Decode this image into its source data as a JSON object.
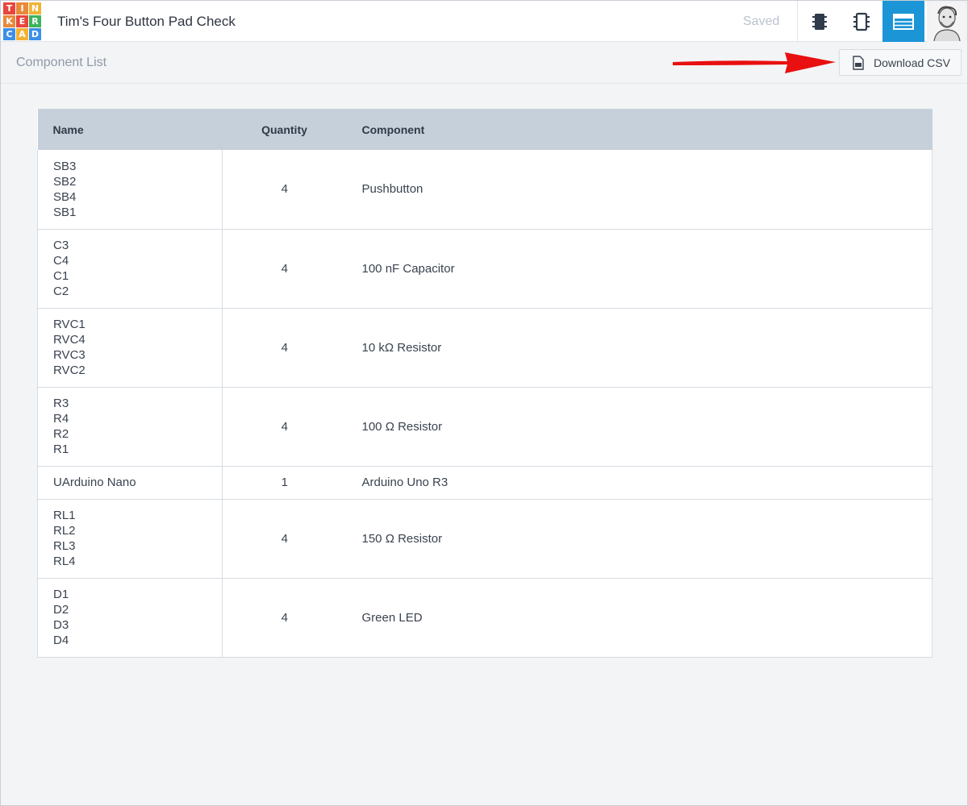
{
  "header": {
    "logo_letters": [
      "T",
      "I",
      "N",
      "K",
      "E",
      "R",
      "C",
      "A",
      "D"
    ],
    "logo_colors": [
      "#e8453c",
      "#e8893c",
      "#f2b233",
      "#e8893c",
      "#e8453c",
      "#3cb45a",
      "#3c8fe8",
      "#f2b233",
      "#3c8fe8"
    ],
    "title": "Tim's Four Button Pad Check",
    "status": "Saved",
    "accent": "#1c95d6"
  },
  "subbar": {
    "title": "Component List",
    "download_label": "Download CSV",
    "arrow_color": "#e81010"
  },
  "table": {
    "columns": [
      "Name",
      "Quantity",
      "Component"
    ],
    "rows": [
      {
        "names": [
          "SB3",
          "SB2",
          "SB4",
          "SB1"
        ],
        "quantity": "4",
        "component": "Pushbutton"
      },
      {
        "names": [
          "C3",
          "C4",
          "C1",
          "C2"
        ],
        "quantity": "4",
        "component": "100 nF Capacitor"
      },
      {
        "names": [
          "RVC1",
          "RVC4",
          "RVC3",
          "RVC2"
        ],
        "quantity": "4",
        "component": "10 kΩ Resistor"
      },
      {
        "names": [
          "R3",
          "R4",
          "R2",
          "R1"
        ],
        "quantity": "4",
        "component": "100 Ω Resistor"
      },
      {
        "names": [
          "UArduino Nano"
        ],
        "quantity": "1",
        "component": "Arduino Uno R3"
      },
      {
        "names": [
          "RL1",
          "RL2",
          "RL3",
          "RL4"
        ],
        "quantity": "4",
        "component": "150 Ω Resistor"
      },
      {
        "names": [
          "D1",
          "D2",
          "D3",
          "D4"
        ],
        "quantity": "4",
        "component": "Green LED"
      }
    ]
  }
}
